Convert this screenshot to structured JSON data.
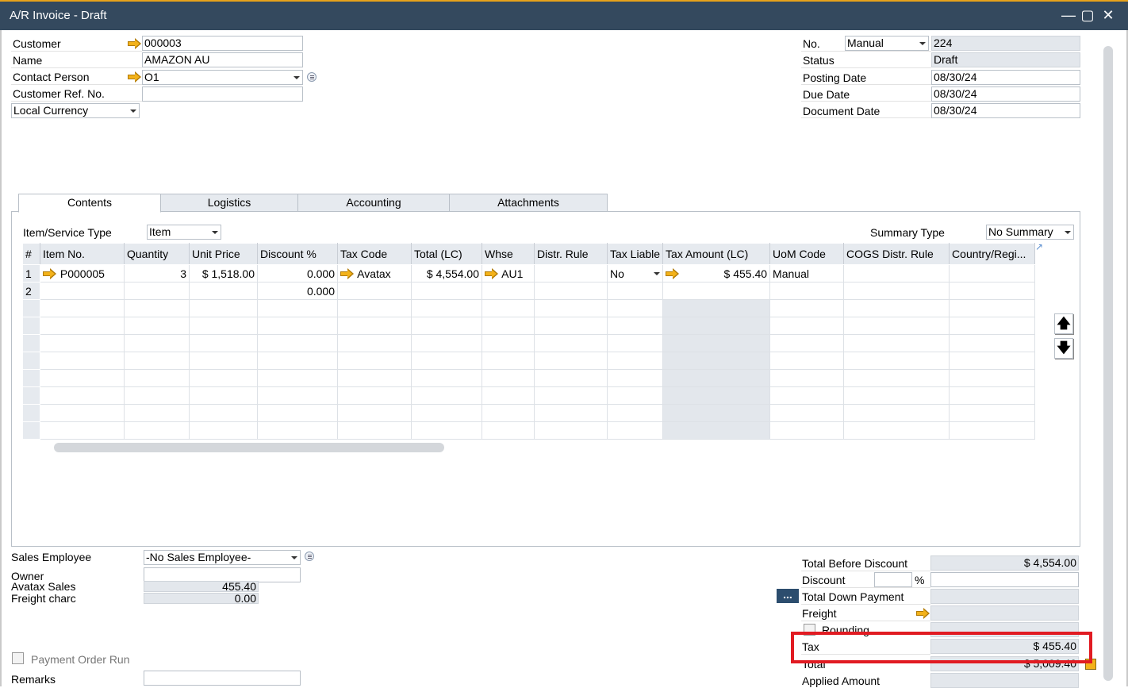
{
  "window": {
    "title": "A/R Invoice - Draft"
  },
  "header_left": {
    "customer_label": "Customer",
    "customer_value": "000003",
    "name_label": "Name",
    "name_value": "AMAZON AU",
    "contact_label": "Contact Person",
    "contact_value": "O1",
    "custref_label": "Customer Ref. No.",
    "custref_value": "",
    "currency_value": "Local Currency"
  },
  "header_right": {
    "no_label": "No.",
    "series_value": "Manual",
    "no_value": "224",
    "status_label": "Status",
    "status_value": "Draft",
    "posting_label": "Posting Date",
    "posting_value": "08/30/24",
    "due_label": "Due Date",
    "due_value": "08/30/24",
    "docdate_label": "Document Date",
    "docdate_value": "08/30/24"
  },
  "tabs": [
    "Contents",
    "Logistics",
    "Accounting",
    "Attachments"
  ],
  "contents": {
    "item_type_label": "Item/Service Type",
    "item_type_value": "Item",
    "summary_label": "Summary Type",
    "summary_value": "No Summary",
    "columns": [
      "#",
      "Item No.",
      "Quantity",
      "Unit Price",
      "Discount %",
      "Tax Code",
      "Total (LC)",
      "Whse",
      "Distr. Rule",
      "Tax Liable",
      "Tax Amount (LC)",
      "UoM Code",
      "COGS Distr. Rule",
      "Country/Regi..."
    ],
    "rows": [
      [
        "1",
        "P000005",
        "3",
        "$ 1,518.00",
        "0.000",
        "Avatax",
        "$ 4,554.00",
        "AU1",
        "",
        "No",
        "$ 455.40",
        "Manual",
        "",
        ""
      ],
      [
        "2",
        "",
        "",
        "",
        "0.000",
        "",
        "",
        "",
        "",
        "",
        "",
        "",
        "",
        ""
      ]
    ]
  },
  "footer_left": {
    "sales_emp_label": "Sales Employee",
    "sales_emp_value": "-No Sales Employee-",
    "owner_label": "Owner",
    "owner_value": "",
    "avatax_label": "Avatax Sales",
    "avatax_value": "455.40",
    "freight_label": "Freight charc",
    "freight_value": "0.00",
    "payment_order_label": "Payment Order Run",
    "remarks_label": "Remarks"
  },
  "totals": {
    "before_discount_label": "Total Before Discount",
    "before_discount_value": "$ 4,554.00",
    "discount_label": "Discount",
    "discount_pct_value": "",
    "pct_symbol": "%",
    "discount_value": "",
    "down_payment_label": "Total Down Payment",
    "down_payment_value": "",
    "dots_label": "...",
    "freight_label": "Freight",
    "freight_value": "",
    "rounding_label": "Rounding",
    "tax_label": "Tax",
    "tax_value": "$ 455.40",
    "total_label": "Total",
    "total_value": "$ 5,009.40",
    "applied_label": "Applied Amount"
  },
  "colors": {
    "titlebar": "#34495e",
    "accent": "#e8a21a",
    "highlight": "#e11b22"
  }
}
